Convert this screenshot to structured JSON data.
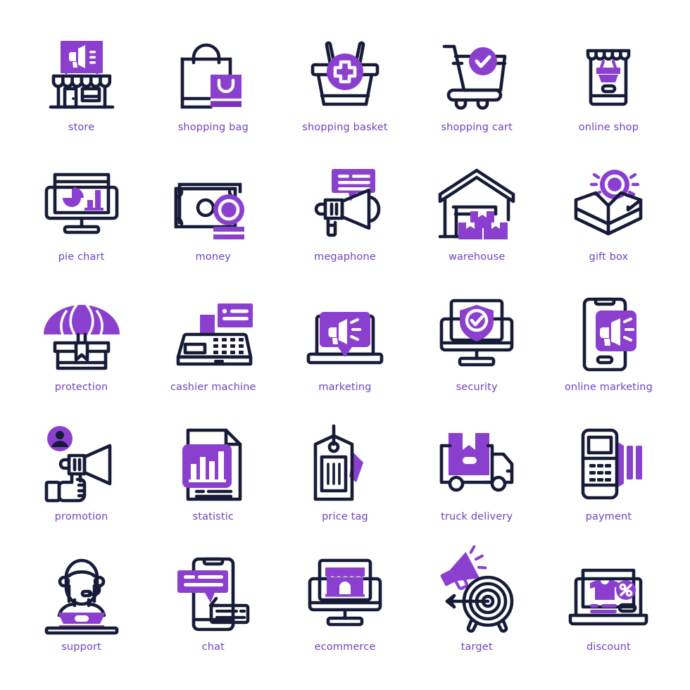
{
  "palette": {
    "background": "#ffffff",
    "outline": "#161C38",
    "accent": "#8B3FCE",
    "accent_dark": "#7B33BE",
    "label": "#7242C0",
    "white": "#ffffff"
  },
  "grid": {
    "columns": 5,
    "rows": 5
  },
  "icons": [
    {
      "id": "store",
      "label": "store",
      "icon_name": "store-icon"
    },
    {
      "id": "shopping-bag",
      "label": "shopping bag",
      "icon_name": "shopping-bag-icon"
    },
    {
      "id": "shopping-basket",
      "label": "shopping basket",
      "icon_name": "shopping-basket-icon"
    },
    {
      "id": "shopping-cart",
      "label": "shopping cart",
      "icon_name": "shopping-cart-icon"
    },
    {
      "id": "online-shop",
      "label": "online shop",
      "icon_name": "online-shop-icon"
    },
    {
      "id": "pie-chart",
      "label": "pie chart",
      "icon_name": "pie-chart-icon"
    },
    {
      "id": "money",
      "label": "money",
      "icon_name": "money-icon"
    },
    {
      "id": "megaphone",
      "label": "megaphone",
      "icon_name": "megaphone-icon"
    },
    {
      "id": "warehouse",
      "label": "warehouse",
      "icon_name": "warehouse-icon"
    },
    {
      "id": "gift-box",
      "label": "gift box",
      "icon_name": "gift-box-icon"
    },
    {
      "id": "protection",
      "label": "protection",
      "icon_name": "protection-umbrella-icon"
    },
    {
      "id": "cashier-machine",
      "label": "cashier machine",
      "icon_name": "cashier-machine-icon"
    },
    {
      "id": "marketing",
      "label": "marketing",
      "icon_name": "marketing-laptop-icon"
    },
    {
      "id": "security",
      "label": "security",
      "icon_name": "security-shield-monitor-icon"
    },
    {
      "id": "online-marketing",
      "label": "online marketing",
      "icon_name": "online-marketing-phone-icon"
    },
    {
      "id": "promotion",
      "label": "promotion",
      "icon_name": "promotion-hand-megaphone-icon"
    },
    {
      "id": "statistic",
      "label": "statistic",
      "icon_name": "statistic-document-icon"
    },
    {
      "id": "price-tag",
      "label": "price tag",
      "icon_name": "price-tag-icon"
    },
    {
      "id": "truck-delivery",
      "label": "truck delivery",
      "icon_name": "truck-delivery-icon"
    },
    {
      "id": "payment",
      "label": "payment",
      "icon_name": "payment-terminal-icon"
    },
    {
      "id": "support",
      "label": "support",
      "icon_name": "support-agent-icon"
    },
    {
      "id": "chat",
      "label": "chat",
      "icon_name": "chat-phone-icon"
    },
    {
      "id": "ecommerce",
      "label": "ecommerce",
      "icon_name": "ecommerce-monitor-icon"
    },
    {
      "id": "target",
      "label": "target",
      "icon_name": "target-megaphone-icon"
    },
    {
      "id": "discount",
      "label": "discount",
      "icon_name": "discount-laptop-icon"
    }
  ]
}
